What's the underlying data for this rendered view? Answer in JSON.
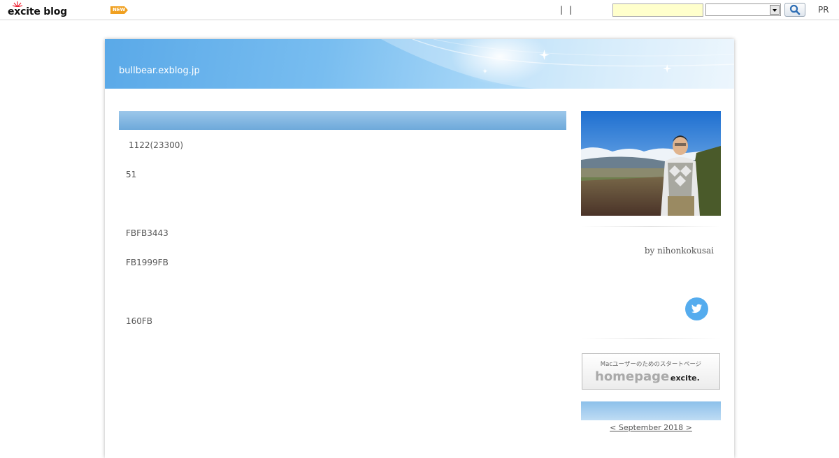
{
  "topbar": {
    "logo_text": "excite blog",
    "new_badge": "NEW",
    "separators": [
      "|",
      "|"
    ],
    "search": {
      "value": "",
      "placeholder": ""
    },
    "search_select": {
      "selected": ""
    },
    "search_icon": "magnifier-icon",
    "pr_label": "PR"
  },
  "blog": {
    "url": "bullbear.exblog.jp"
  },
  "post": {
    "lines": [
      "1122(23300)",
      "51",
      "FBFB3443",
      "FB1999FB",
      "160FB"
    ]
  },
  "sidebar": {
    "profile_photo": "profile-photo",
    "author": "by nihonkokusai",
    "twitter_icon": "twitter-bird-icon",
    "banner": {
      "tagline": "Macユーザーのためのスタートページ",
      "homepage": "homepage.",
      "brand": "excite."
    },
    "calendar_nav": "< September 2018 >"
  },
  "colors": {
    "header_blue": "#78bdf0",
    "search_bg": "#ffffcc",
    "twitter": "#55acee",
    "new_badge": "#f0a020"
  }
}
